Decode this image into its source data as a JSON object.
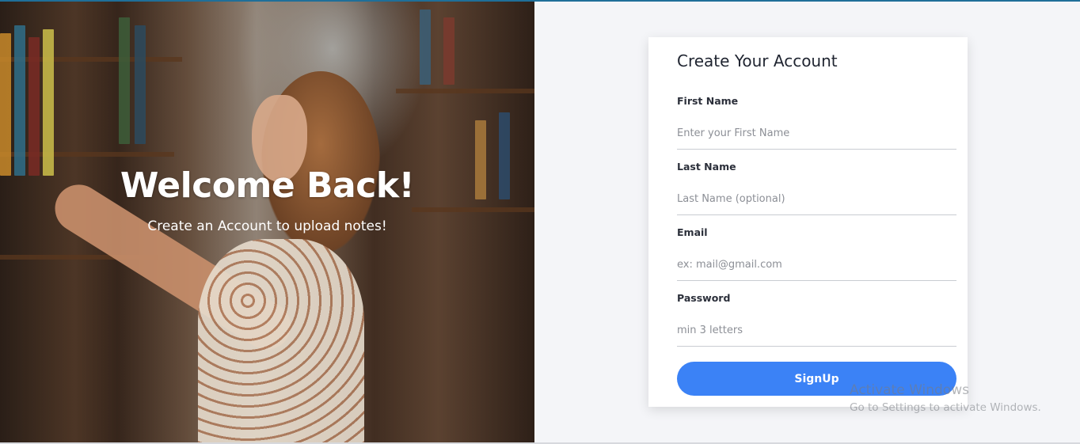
{
  "hero": {
    "title": "Welcome Back!",
    "subtitle": "Create an Account to upload notes!"
  },
  "form": {
    "title": "Create Your Account",
    "fields": [
      {
        "label": "First Name",
        "placeholder": "Enter your First Name"
      },
      {
        "label": "Last Name",
        "placeholder": "Last Name (optional)"
      },
      {
        "label": "Email",
        "placeholder": "ex: mail@gmail.com"
      },
      {
        "label": "Password",
        "placeholder": "min 3 letters"
      }
    ],
    "submit_label": "SignUp"
  },
  "watermark": {
    "line1": "Activate Windows",
    "line2": "Go to Settings to activate Windows."
  },
  "colors": {
    "accent": "#3b82f6",
    "background": "#f4f5f8",
    "card": "#ffffff"
  }
}
